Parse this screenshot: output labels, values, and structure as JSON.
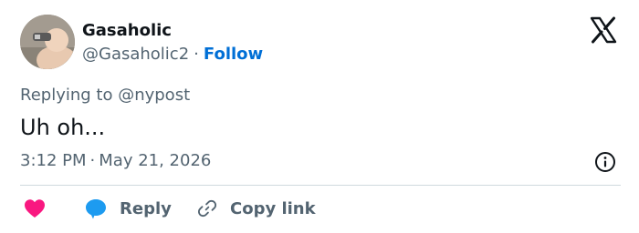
{
  "user": {
    "display_name": "Gasaholic",
    "handle": "@Gasaholic2",
    "separator": "·",
    "follow_label": "Follow"
  },
  "tweet": {
    "replying_to": "Replying to @nypost",
    "text": "Uh oh...",
    "time": "3:12 PM",
    "date": "May 21, 2026",
    "date_separator": "·"
  },
  "actions": {
    "reply_label": "Reply",
    "copy_link_label": "Copy link"
  },
  "icons": {
    "brand": "x-logo-icon",
    "info": "info-icon",
    "like": "heart-icon",
    "reply": "speech-bubble-icon",
    "copy": "link-icon"
  },
  "colors": {
    "follow": "#006fd6",
    "like": "#f91880",
    "reply": "#1d9bf0",
    "muted": "#536471",
    "divider": "#cfd9de"
  }
}
